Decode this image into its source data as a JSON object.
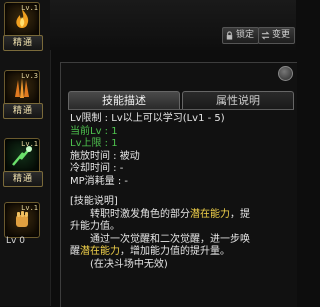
{
  "sidebar": {
    "slots": [
      {
        "level": "Lv.1",
        "badge": "精通"
      },
      {
        "level": "Lv.3",
        "badge": "精通"
      },
      {
        "level": "Lv.1",
        "badge": "精通"
      },
      {
        "level": "Lv.1",
        "lv_label": "Lv 0"
      }
    ]
  },
  "topbar": {
    "lock_label": "锁定",
    "change_label": "变更"
  },
  "tabs": {
    "active": "技能描述",
    "inactive": "属性说明"
  },
  "skill": {
    "lv_limit_label": "Lv限制 : ",
    "lv_limit_value": "Lv以上可以学习(Lv1 - 5)",
    "current_lv_label": "当前Lv : ",
    "current_lv_value": "1",
    "lv_max_label": "Lv上限 : ",
    "lv_max_value": "1",
    "cast_time": "施放时间 : 被动",
    "cooldown": "冷却时间 : -",
    "mp_cost": "MP消耗量 : -"
  },
  "description": {
    "header": "[技能说明]",
    "line1_a": "转职时激发角色的部分",
    "line1_b": "潜在能力",
    "line1_c": "，提",
    "line2": "升能力值。",
    "line3": "通过一次觉醒和二次觉醒，进一步唤",
    "line4_a": "醒",
    "line4_b": "潜在能力",
    "line4_c": "，增加能力值的提升量。",
    "line5": "(在决斗场中无效)"
  },
  "colors": {
    "green": "#4ec24e",
    "yellow": "#f2d24a"
  }
}
